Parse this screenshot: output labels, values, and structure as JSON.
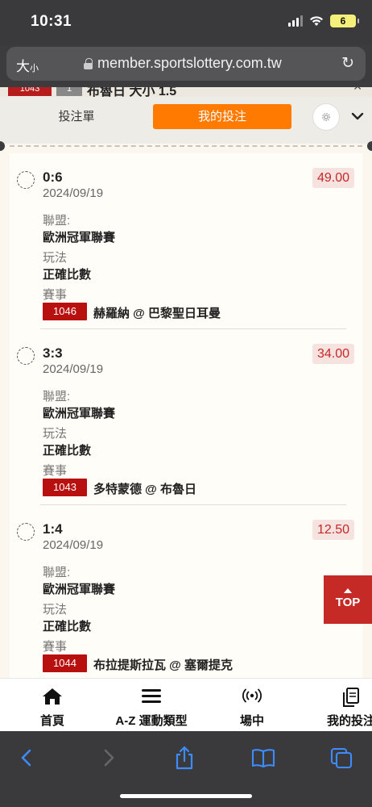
{
  "status": {
    "time": "10:31",
    "battery": "6"
  },
  "browser": {
    "text_size": "大",
    "text_size_small": "小",
    "url": "member.sportslottery.com.tw"
  },
  "peek": {
    "code": "1043",
    "num": "1",
    "text": "布魯日 大小 1.5"
  },
  "tabs": {
    "slip": "投注單",
    "my_bets": "我的投注"
  },
  "labels": {
    "league": "聯盟:",
    "play": "玩法",
    "match": "賽事"
  },
  "bets": [
    {
      "score": "0:6",
      "date": "2024/09/19",
      "odds": "49.00",
      "league": "歐洲冠軍聯賽",
      "play": "正確比數",
      "code": "1046",
      "match": "赫羅納 @ 巴黎聖日耳曼"
    },
    {
      "score": "3:3",
      "date": "2024/09/19",
      "odds": "34.00",
      "league": "歐洲冠軍聯賽",
      "play": "正確比數",
      "code": "1043",
      "match": "多特蒙德 @ 布魯日"
    },
    {
      "score": "1:4",
      "date": "2024/09/19",
      "odds": "12.50",
      "league": "歐洲冠軍聯賽",
      "play": "正確比數",
      "code": "1044",
      "match": "布拉提斯拉瓦 @ 塞爾提克"
    }
  ],
  "top_button": "TOP",
  "nav": {
    "home": "首頁",
    "az": "A-Z 運動類型",
    "live": "場中",
    "mybets": "我的投注"
  },
  "colors": {
    "accent": "#ff7a00",
    "brand_red": "#b80f0f",
    "odds_red": "#c62828"
  }
}
